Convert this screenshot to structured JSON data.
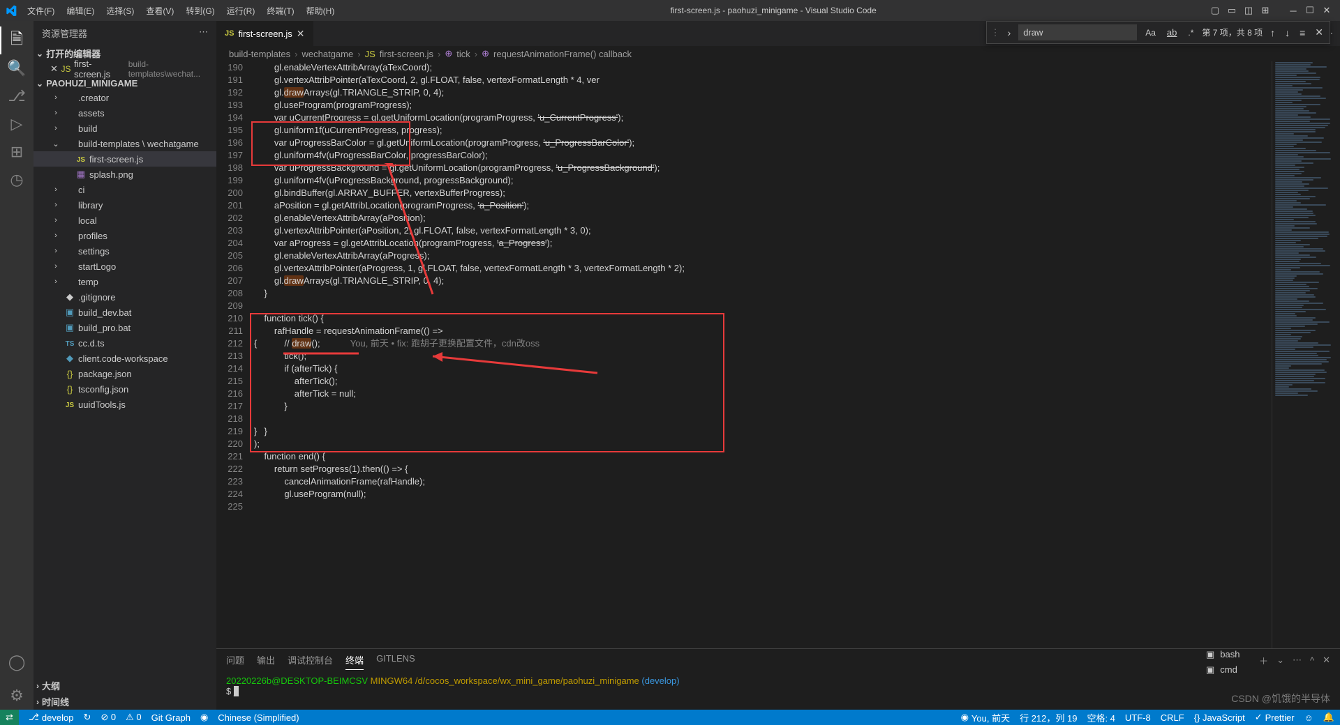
{
  "title": "first-screen.js - paohuzi_minigame - Visual Studio Code",
  "menu": [
    "文件(F)",
    "编辑(E)",
    "选择(S)",
    "查看(V)",
    "转到(G)",
    "运行(R)",
    "终端(T)",
    "帮助(H)"
  ],
  "sidebar": {
    "title": "资源管理器",
    "open_editors": "打开的编辑器",
    "open_file": "first-screen.js",
    "open_path": "build-templates\\wechat...",
    "root": "PAOHUZI_MINIGAME",
    "items": [
      {
        "name": ".creator",
        "t": "folder"
      },
      {
        "name": "assets",
        "t": "folder"
      },
      {
        "name": "build",
        "t": "folder"
      },
      {
        "name": "build-templates \\ wechatgame",
        "t": "folder",
        "open": true
      },
      {
        "name": "first-screen.js",
        "t": "js",
        "indent": true,
        "sel": true
      },
      {
        "name": "splash.png",
        "t": "img",
        "indent": true
      },
      {
        "name": "ci",
        "t": "folder"
      },
      {
        "name": "library",
        "t": "folder"
      },
      {
        "name": "local",
        "t": "folder"
      },
      {
        "name": "profiles",
        "t": "folder"
      },
      {
        "name": "settings",
        "t": "folder"
      },
      {
        "name": "startLogo",
        "t": "folder"
      },
      {
        "name": "temp",
        "t": "folder"
      },
      {
        "name": ".gitignore",
        "t": "file"
      },
      {
        "name": "build_dev.bat",
        "t": "bat"
      },
      {
        "name": "build_pro.bat",
        "t": "bat"
      },
      {
        "name": "cc.d.ts",
        "t": "ts"
      },
      {
        "name": "client.code-workspace",
        "t": "ws"
      },
      {
        "name": "package.json",
        "t": "json"
      },
      {
        "name": "tsconfig.json",
        "t": "json"
      },
      {
        "name": "uuidTools.js",
        "t": "js"
      }
    ],
    "outline": "大纲",
    "timeline": "时间线"
  },
  "tab": {
    "name": "first-screen.js",
    "icon": "JS"
  },
  "breadcrumb": [
    "build-templates",
    "wechatgame",
    "first-screen.js",
    "tick",
    "requestAnimationFrame() callback"
  ],
  "find": {
    "value": "draw",
    "result": "第 7 项，共 8 项"
  },
  "lines_start": 190,
  "lines_end": 225,
  "blame": "You, 前天 • fix: 跑胡子更换配置文件，cdn改oss",
  "code": [
    "        gl.<f>enableVertexAttribArray</f>(<v>aTexCoord</v>);",
    "        gl.<f>vertexAttribPointer</f>(<v>aTexCoord</v>, <n>2</n>, gl.<v>FLOAT</v>, <k>false</k>, <v>vertexFormatLength</v> * <n>4</n>, ver",
    "        gl.<f><span class='hl'>draw</span>Arrays</f>(gl.<v>TRIANGLE_STRIP</v>, <n>0</n>, <n>4</n>);",
    "        gl.<f>useProgram</f>(<v>programProgress</v>);",
    "        <k>var</k> <v>uCurrentProgress</v> = gl.<f>getUniformLocation</f>(<v>programProgress</v>, <s>'u_CurrentProgress'</s>);",
    "        gl.<f>uniform1f</f>(<v>uCurrentProgress</v>, <v>progress</v>);",
    "        <k>var</k> <v>uProgressBarColor</v> = gl.<f>getUniformLocation</f>(<v>programProgress</v>, <s>'u_ProgressBarColor'</s>);",
    "        gl.<f>uniform4fv</f>(<v>uProgressBarColor</v>, <v>progressBarColor</v>);",
    "        <k>var</k> <v>uProgressBackground</v> = gl.<f>getUniformLocation</f>(<v>programProgress</v>, <s>'u_ProgressBackground'</s>);",
    "        gl.<f>uniform4fv</f>(<v>uProgressBackground</v>, <v>progressBackground</v>);",
    "        gl.<f>bindBuffer</f>(gl.<v>ARRAY_BUFFER</v>, <v>vertexBufferProgress</v>);",
    "        <v>aPosition</v> = gl.<f>getAttribLocation</f>(<v>programProgress</v>, <s>'a_Position'</s>);",
    "        gl.<f>enableVertexAttribArray</f>(<v>aPosition</v>);",
    "        gl.<f>vertexAttribPointer</f>(<v>aPosition</v>, <n>2</n>, gl.<v>FLOAT</v>, <k>false</k>, <v>vertexFormatLength</v> * <n>3</n>, <n>0</n>);",
    "        <k>var</k> <v>aProgress</v> = gl.<f>getAttribLocation</f>(<v>programProgress</v>, <s>'a_Progress'</s>);",
    "        gl.<f>enableVertexAttribArray</f>(<v>aProgress</v>);",
    "        gl.<f>vertexAttribPointer</f>(<v>aProgress</v>, <n>1</n>, gl.<v>FLOAT</v>, <k>false</k>, <v>vertexFormatLength</v> * <n>3</n>, <v>vertexFormatLength</v> * <n>2</n>);",
    "        gl.<f><span class='hl'>draw</span>Arrays</f>(gl.<v>TRIANGLE_STRIP</v>, <n>0</n>, <n>4</n>);",
    "    }",
    "",
    "    <k>function</k> <f>tick</f>() {",
    "        <v>rafHandle</v> = <f>requestAnimationFrame</f>(() <k>=&gt;</k> <p>{</p>",
    "            <c>// <span class='hl'>draw</span>();</c>",
    "            <f>tick</f>();",
    "            <k>if</k> (<v>afterTick</v>) {",
    "                <f>afterTick</f>();",
    "                <v>afterTick</v> = <k>null</k>;",
    "            }",
    "        <p>}</p>);",
    "    }",
    "",
    "    <k>function</k> <f>end</f>() {",
    "        <k>return</k> <f>setProgress</f>(<n>1</n>).<f>then</f>(() <k>=&gt;</k> {",
    "            <f>cancelAnimationFrame</f>(<v>rafHandle</v>);",
    "            gl.<f>useProgram</f>(<k>null</k>);"
  ],
  "panel": {
    "tabs": [
      "问题",
      "输出",
      "调试控制台",
      "终端",
      "GITLENS"
    ],
    "active": 3
  },
  "terminal": {
    "line1_user": "20220226b@DESKTOP-BEIMCSV",
    "line1_mingw": "MINGW64",
    "line1_path": "/d/cocos_workspace/wx_mini_game/paohuzi_minigame",
    "line1_branch": "(develop)",
    "prompt": "$ ",
    "shells": [
      "bash",
      "cmd"
    ]
  },
  "status": {
    "branch": "develop",
    "sync": "↻",
    "errors": "⊘ 0",
    "warns": "⚠ 0",
    "gitgraph": "Git Graph",
    "live": "◉",
    "lang_left": "Chinese (Simplified)",
    "blame": "You, 前天",
    "pos": "行 212，列 19",
    "spaces": "空格: 4",
    "enc": "UTF-8",
    "eol": "CRLF",
    "lang": "{} JavaScript",
    "prettier": "Prettier",
    "bell": "✓"
  },
  "watermark": "CSDN @饥饿的半导体"
}
